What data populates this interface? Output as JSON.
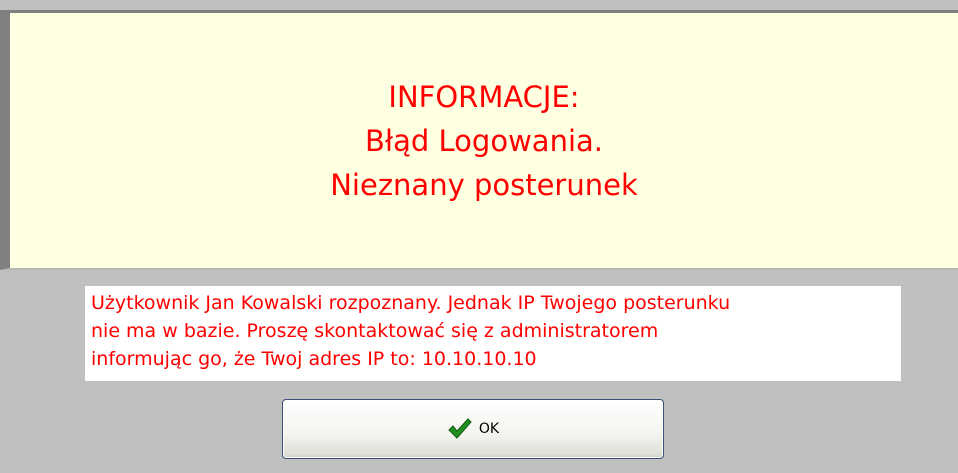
{
  "info": {
    "lines": [
      "INFORMACJE:",
      "Błąd Logowania.",
      "Nieznany posterunek"
    ]
  },
  "message": {
    "lines": [
      "Użytkownik Jan  Kowalski rozpoznany. Jednak IP Twojego posterunku",
      "nie ma w bazie. Proszę skontaktować się z administratorem",
      "informując go, że Twoj adres IP to: 10.10.10.10"
    ]
  },
  "ok_button": {
    "label": "OK",
    "icon": "checkmark-icon"
  },
  "colors": {
    "panel_bg": "#ffffe1",
    "text": "#ff0000",
    "dialog_bg": "#c0c0c0",
    "check": "#1f8f1f"
  }
}
